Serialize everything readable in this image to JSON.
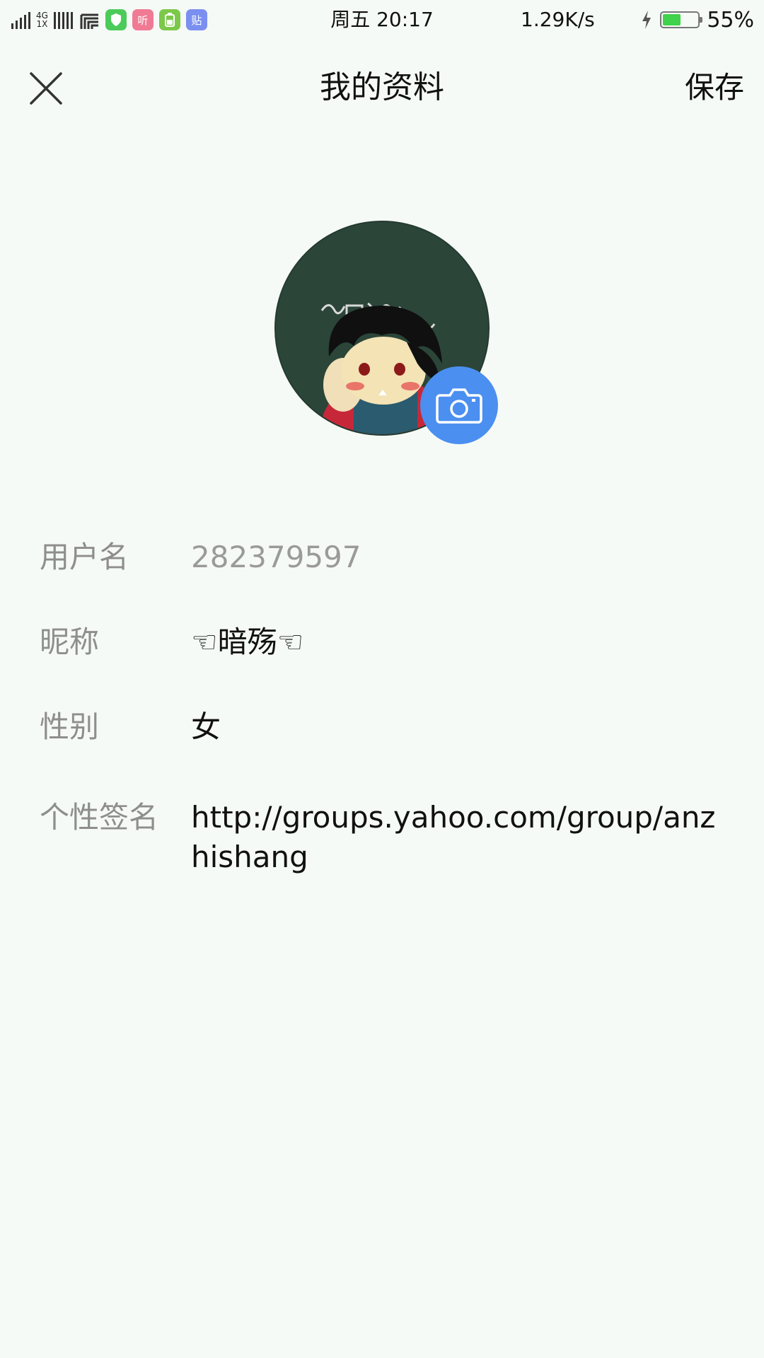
{
  "status_bar": {
    "network_type_top": "4G",
    "network_type_bottom": "1X",
    "app_badges": [
      {
        "icon": "shield-icon",
        "label": "",
        "color": "#4ccb5a"
      },
      {
        "icon": "listen-icon",
        "label": "听",
        "color": "#f07a94"
      },
      {
        "icon": "battery-app-icon",
        "label": "",
        "color": "#7cc84a"
      },
      {
        "icon": "tieba-icon",
        "label": "贴",
        "color": "#7a8ff0"
      }
    ],
    "time": "周五  20:17",
    "speed": "1.29K/s",
    "battery_percent": "55%",
    "battery_level": 0.55,
    "battery_color": "#3fd24a"
  },
  "header": {
    "title": "我的资料",
    "save_label": "保存"
  },
  "profile": {
    "accent_color": "#4b8ff0",
    "fields": [
      {
        "label": "用户名",
        "value": "282379597",
        "editable": false
      },
      {
        "label": "昵称",
        "value": "☜暗殇☜",
        "editable": true
      },
      {
        "label": "性别",
        "value": "女",
        "editable": true
      },
      {
        "label": "个性签名",
        "value": "http://groups.yahoo.com/group/anzhishang",
        "editable": true
      }
    ]
  }
}
